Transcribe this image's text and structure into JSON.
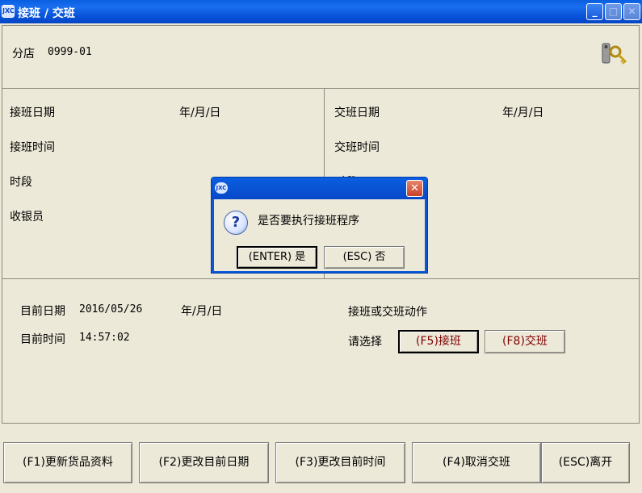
{
  "window": {
    "title": "接班 / 交班",
    "minimize_label": "_",
    "maximize_label": "□",
    "close_label": "✕"
  },
  "store": {
    "label": "分店",
    "code": "0999-01"
  },
  "handover_in": {
    "date_label": "接班日期",
    "date_format": "年/月/日",
    "time_label": "接班时间",
    "period_label": "时段",
    "cashier_label": "收银员"
  },
  "handover_out": {
    "date_label": "交班日期",
    "date_format": "年/月/日",
    "time_label": "交班时间",
    "period_label": "时段"
  },
  "current": {
    "date_label": "目前日期",
    "date_value": "2016/05/26",
    "date_format": "年/月/日",
    "time_label": "目前时间",
    "time_value": "14:57:02"
  },
  "action": {
    "title": "接班或交班动作",
    "select_label": "请选择",
    "f5_label": "(F5)接班",
    "f8_label": "(F8)交班"
  },
  "dialog": {
    "message": "是否要执行接班程序",
    "yes_label": "(ENTER) 是",
    "no_label": "(ESC) 否",
    "close_label": "✕"
  },
  "footer": {
    "f1_label": "(F1)更新货品资料",
    "f2_label": "(F2)更改目前日期",
    "f3_label": "(F3)更改目前时间",
    "f4_label": "(F4)取消交班",
    "esc_label": "(ESC)离开"
  },
  "icons": {
    "app": "app-logo-icon",
    "keys": "keys-icon",
    "question": "question-icon"
  },
  "colors": {
    "titlebar": "#0a5fe0",
    "window_bg": "#ece9d8",
    "button_text_red": "#800000"
  }
}
